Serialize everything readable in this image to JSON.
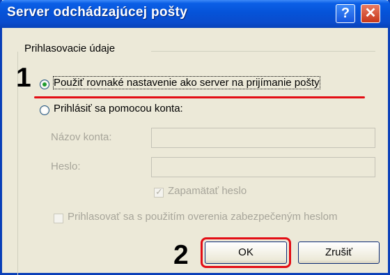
{
  "window": {
    "title": "Server odchádzajúcej pošty",
    "help_glyph": "?",
    "close_glyph": "✕"
  },
  "group": {
    "title": "Prihlasovacie údaje"
  },
  "steps": {
    "one": "1",
    "two": "2"
  },
  "options": {
    "same_settings": {
      "label": "Použiť rovnaké nastavenie ako server na prijímanie pošty",
      "selected": true
    },
    "login_account": {
      "label": "Prihlásiť sa pomocou konta:",
      "selected": false
    }
  },
  "fields": {
    "account_name": {
      "label": "Názov konta:",
      "value": ""
    },
    "password": {
      "label": "Heslo:",
      "value": ""
    }
  },
  "checkboxes": {
    "remember_password": {
      "label": "Zapamätať heslo",
      "checked": true,
      "enabled": false
    },
    "spa": {
      "label": "Prihlasovať sa s použitím overenia zabezpečeným heslom",
      "checked": false,
      "enabled": false
    }
  },
  "buttons": {
    "ok": "OK",
    "cancel": "Zrušiť"
  },
  "colors": {
    "titlebar": "#0553d8",
    "highlight": "#e30d14",
    "dialog_bg": "#ece9d8"
  }
}
